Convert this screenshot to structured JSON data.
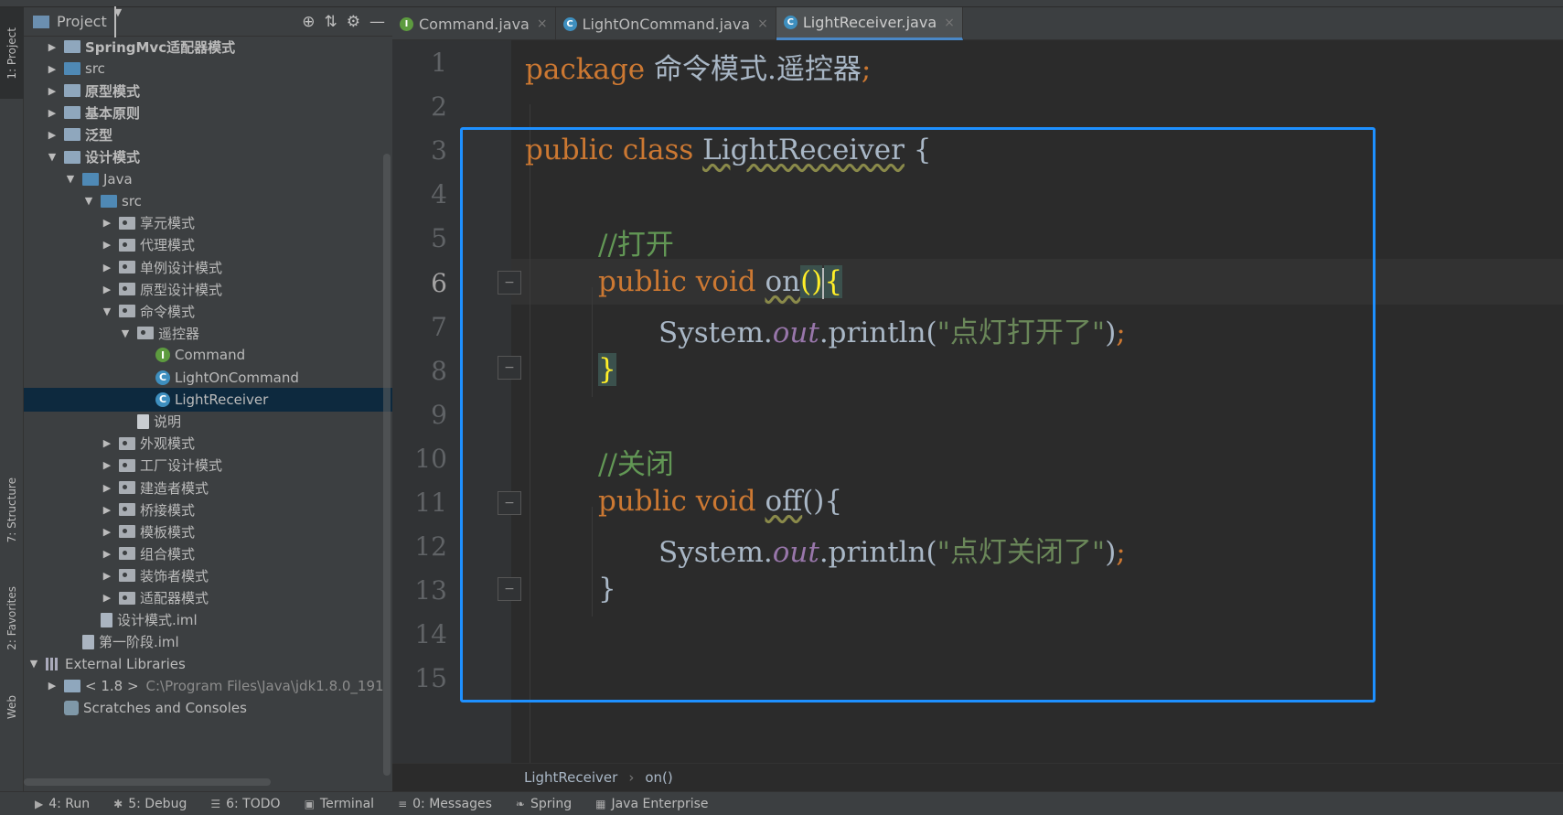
{
  "project_panel": {
    "title": "Project",
    "tree": [
      {
        "label": "SpringMvc适配器模式",
        "indent": 0,
        "arrow": "▶",
        "icon": "folder-module-icon",
        "bold": true
      },
      {
        "label": "src",
        "indent": 0,
        "arrow": "▶",
        "icon": "folder-src-icon"
      },
      {
        "label": "原型模式",
        "indent": 0,
        "arrow": "▶",
        "icon": "folder-module-icon",
        "bold": true
      },
      {
        "label": "基本原则",
        "indent": 0,
        "arrow": "▶",
        "icon": "folder-module-icon",
        "bold": true
      },
      {
        "label": "泛型",
        "indent": 0,
        "arrow": "▶",
        "icon": "folder-module-icon",
        "bold": true
      },
      {
        "label": "设计模式",
        "indent": 0,
        "arrow": "▼",
        "icon": "folder-module-icon",
        "bold": true
      },
      {
        "label": "Java",
        "indent": 1,
        "arrow": "▼",
        "icon": "folder-icon"
      },
      {
        "label": "src",
        "indent": 2,
        "arrow": "▼",
        "icon": "folder-src-icon"
      },
      {
        "label": "享元模式",
        "indent": 3,
        "arrow": "▶",
        "icon": "package-icon"
      },
      {
        "label": "代理模式",
        "indent": 3,
        "arrow": "▶",
        "icon": "package-icon"
      },
      {
        "label": "单例设计模式",
        "indent": 3,
        "arrow": "▶",
        "icon": "package-icon"
      },
      {
        "label": "原型设计模式",
        "indent": 3,
        "arrow": "▶",
        "icon": "package-icon"
      },
      {
        "label": "命令模式",
        "indent": 3,
        "arrow": "▼",
        "icon": "package-icon"
      },
      {
        "label": "遥控器",
        "indent": 4,
        "arrow": "▼",
        "icon": "package-icon"
      },
      {
        "label": "Command",
        "indent": 5,
        "arrow": "",
        "icon": "interface-icon"
      },
      {
        "label": "LightOnCommand",
        "indent": 5,
        "arrow": "",
        "icon": "class-icon"
      },
      {
        "label": "LightReceiver",
        "indent": 5,
        "arrow": "",
        "icon": "class-icon",
        "selected": true
      },
      {
        "label": "说明",
        "indent": 4,
        "arrow": "",
        "icon": "text-file-icon"
      },
      {
        "label": "外观模式",
        "indent": 3,
        "arrow": "▶",
        "icon": "package-icon"
      },
      {
        "label": "工厂设计模式",
        "indent": 3,
        "arrow": "▶",
        "icon": "package-icon"
      },
      {
        "label": "建造者模式",
        "indent": 3,
        "arrow": "▶",
        "icon": "package-icon"
      },
      {
        "label": "桥接模式",
        "indent": 3,
        "arrow": "▶",
        "icon": "package-icon"
      },
      {
        "label": "模板模式",
        "indent": 3,
        "arrow": "▶",
        "icon": "package-icon"
      },
      {
        "label": "组合模式",
        "indent": 3,
        "arrow": "▶",
        "icon": "package-icon"
      },
      {
        "label": "装饰者模式",
        "indent": 3,
        "arrow": "▶",
        "icon": "package-icon"
      },
      {
        "label": "适配器模式",
        "indent": 3,
        "arrow": "▶",
        "icon": "package-icon"
      },
      {
        "label": "设计模式.iml",
        "indent": 2,
        "arrow": "",
        "icon": "iml-file-icon"
      },
      {
        "label": "第一阶段.iml",
        "indent": 1,
        "arrow": "",
        "icon": "iml-file-icon"
      },
      {
        "label": "External Libraries",
        "indent": 0,
        "arrow": "▼",
        "icon": "libraries-icon",
        "outdent": true
      },
      {
        "label": "< 1.8 >",
        "path": "C:\\Program Files\\Java\\jdk1.8.0_191",
        "indent": 1,
        "arrow": "▶",
        "icon": "jdk-icon",
        "outdent": true
      },
      {
        "label": "Scratches and Consoles",
        "indent": 1,
        "arrow": "",
        "icon": "scratches-icon",
        "outdent": true
      }
    ]
  },
  "left_strip": {
    "project": "1: Project",
    "structure": "7: Structure",
    "favorites": "2: Favorites",
    "web": "Web"
  },
  "tabs": [
    {
      "label": "Command.java",
      "icon": "interface-icon",
      "color": "#5d9b3f",
      "letter": "I",
      "active": false
    },
    {
      "label": "LightOnCommand.java",
      "icon": "class-icon",
      "color": "#3e8fbf",
      "letter": "C",
      "active": false
    },
    {
      "label": "LightReceiver.java",
      "icon": "class-icon",
      "color": "#3e8fbf",
      "letter": "C",
      "active": true
    }
  ],
  "editor": {
    "current_line": 6,
    "line_numbers": [
      "1",
      "2",
      "3",
      "4",
      "5",
      "6",
      "7",
      "8",
      "9",
      "10",
      "11",
      "12",
      "13",
      "14",
      "15"
    ],
    "code": {
      "l1_kw": "package",
      "l1_pkg": " 命令模式.遥控器",
      "l1_semi": ";",
      "l3_kw": "public class",
      "l3_name": "LightReceiver",
      "l3_brace": " {",
      "l5_comment": "//打开",
      "l6_kw": "public void",
      "l6_name": "on",
      "l6_parens": "()",
      "l6_brace": "{",
      "l7_sys": "System.",
      "l7_out": "out",
      "l7_call": ".println(",
      "l7_str": "\"点灯打开了\"",
      "l7_end": ")",
      "l7_semi": ";",
      "l8_brace": "}",
      "l10_comment": "//关闭",
      "l11_kw": "public void",
      "l11_name": "off",
      "l11_rest": "(){",
      "l12_sys": "System.",
      "l12_out": "out",
      "l12_call": ".println(",
      "l12_str": "\"点灯关闭了\"",
      "l12_end": ")",
      "l12_semi": ";",
      "l13_brace": "}"
    }
  },
  "breadcrumb": {
    "class": "LightReceiver",
    "method": "on()"
  },
  "bottom_bar": [
    {
      "label": "4: Run",
      "icon": "run-icon"
    },
    {
      "label": "5: Debug",
      "icon": "debug-icon"
    },
    {
      "label": "6: TODO",
      "icon": "todo-icon"
    },
    {
      "label": "Terminal",
      "icon": "terminal-icon"
    },
    {
      "label": "0: Messages",
      "icon": "messages-icon"
    },
    {
      "label": "Spring",
      "icon": "spring-icon"
    },
    {
      "label": "Java Enterprise",
      "icon": "java-enterprise-icon"
    }
  ],
  "colors": {
    "selection": "#0d293e",
    "highlight_box": "#1e90ff",
    "keyword": "#cc7832",
    "comment": "#629755",
    "string": "#6a8759"
  }
}
